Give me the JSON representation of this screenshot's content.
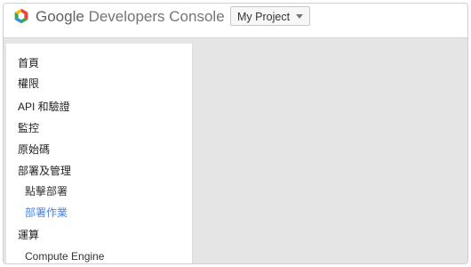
{
  "header": {
    "brand_google": "Google",
    "brand_rest": "Developers Console",
    "project_selector": "My Project",
    "logo_colors": [
      "#ea4335",
      "#fbbc05",
      "#34a853",
      "#4285f4"
    ]
  },
  "sidebar": {
    "items": [
      {
        "label": "首頁"
      },
      {
        "label": "權限"
      },
      {
        "label": "API 和驗證"
      },
      {
        "label": "監控"
      },
      {
        "label": "原始碼"
      },
      {
        "label": "部署及管理"
      },
      {
        "label": "點擊部署"
      },
      {
        "label": "部署作業",
        "active": true
      },
      {
        "label": "運算"
      },
      {
        "label": "Compute Engine"
      }
    ]
  },
  "colors": {
    "accent": "#4285f4",
    "content_bg": "#e5e5e5"
  }
}
